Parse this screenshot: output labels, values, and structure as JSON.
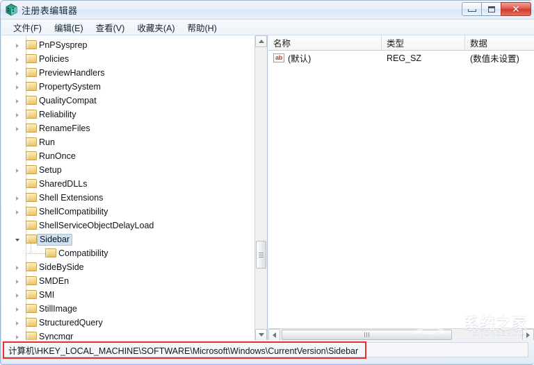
{
  "window": {
    "title": "注册表编辑器",
    "icon": "registry-editor-icon",
    "buttons": {
      "minimize": "–",
      "maximize": "□",
      "close": "✕"
    }
  },
  "menubar": {
    "items": [
      {
        "label": "文件(F)"
      },
      {
        "label": "编辑(E)"
      },
      {
        "label": "查看(V)"
      },
      {
        "label": "收藏夹(A)"
      },
      {
        "label": "帮助(H)"
      }
    ]
  },
  "tree": {
    "items": [
      {
        "label": "PnPSysprep",
        "indent": 1,
        "state": "collapsed"
      },
      {
        "label": "Policies",
        "indent": 1,
        "state": "collapsed"
      },
      {
        "label": "PreviewHandlers",
        "indent": 1,
        "state": "collapsed"
      },
      {
        "label": "PropertySystem",
        "indent": 1,
        "state": "collapsed"
      },
      {
        "label": "QualityCompat",
        "indent": 1,
        "state": "collapsed"
      },
      {
        "label": "Reliability",
        "indent": 1,
        "state": "collapsed"
      },
      {
        "label": "RenameFiles",
        "indent": 1,
        "state": "collapsed"
      },
      {
        "label": "Run",
        "indent": 1,
        "state": "leaf"
      },
      {
        "label": "RunOnce",
        "indent": 1,
        "state": "leaf"
      },
      {
        "label": "Setup",
        "indent": 1,
        "state": "collapsed"
      },
      {
        "label": "SharedDLLs",
        "indent": 1,
        "state": "leaf"
      },
      {
        "label": "Shell Extensions",
        "indent": 1,
        "state": "collapsed"
      },
      {
        "label": "ShellCompatibility",
        "indent": 1,
        "state": "collapsed"
      },
      {
        "label": "ShellServiceObjectDelayLoad",
        "indent": 1,
        "state": "leaf"
      },
      {
        "label": "Sidebar",
        "indent": 1,
        "state": "expanded",
        "selected": true
      },
      {
        "label": "Compatibility",
        "indent": 2,
        "state": "leaf"
      },
      {
        "label": "SideBySide",
        "indent": 1,
        "state": "collapsed"
      },
      {
        "label": "SMDEn",
        "indent": 1,
        "state": "collapsed"
      },
      {
        "label": "SMI",
        "indent": 1,
        "state": "collapsed"
      },
      {
        "label": "StillImage",
        "indent": 1,
        "state": "collapsed"
      },
      {
        "label": "StructuredQuery",
        "indent": 1,
        "state": "collapsed"
      },
      {
        "label": "Syncmgr",
        "indent": 1,
        "state": "collapsed"
      }
    ]
  },
  "values_list": {
    "columns": [
      {
        "label": "名称"
      },
      {
        "label": "类型"
      },
      {
        "label": "数据"
      }
    ],
    "rows": [
      {
        "icon": "ab-string-icon",
        "name": "(默认)",
        "type": "REG_SZ",
        "data": "(数值未设置)"
      }
    ]
  },
  "statusbar": {
    "path": "计算机\\HKEY_LOCAL_MACHINE\\SOFTWARE\\Microsoft\\Windows\\CurrentVersion\\Sidebar"
  },
  "watermark": {
    "text": "系统之家",
    "subtext": "XITONGZHIJIA"
  },
  "colors": {
    "selection_fill": "#cfe3f7",
    "selection_border": "#9cc2e8",
    "highlight_box": "#e8312a",
    "folder": "#f3d88c",
    "close_button": "#cf3a2b"
  }
}
